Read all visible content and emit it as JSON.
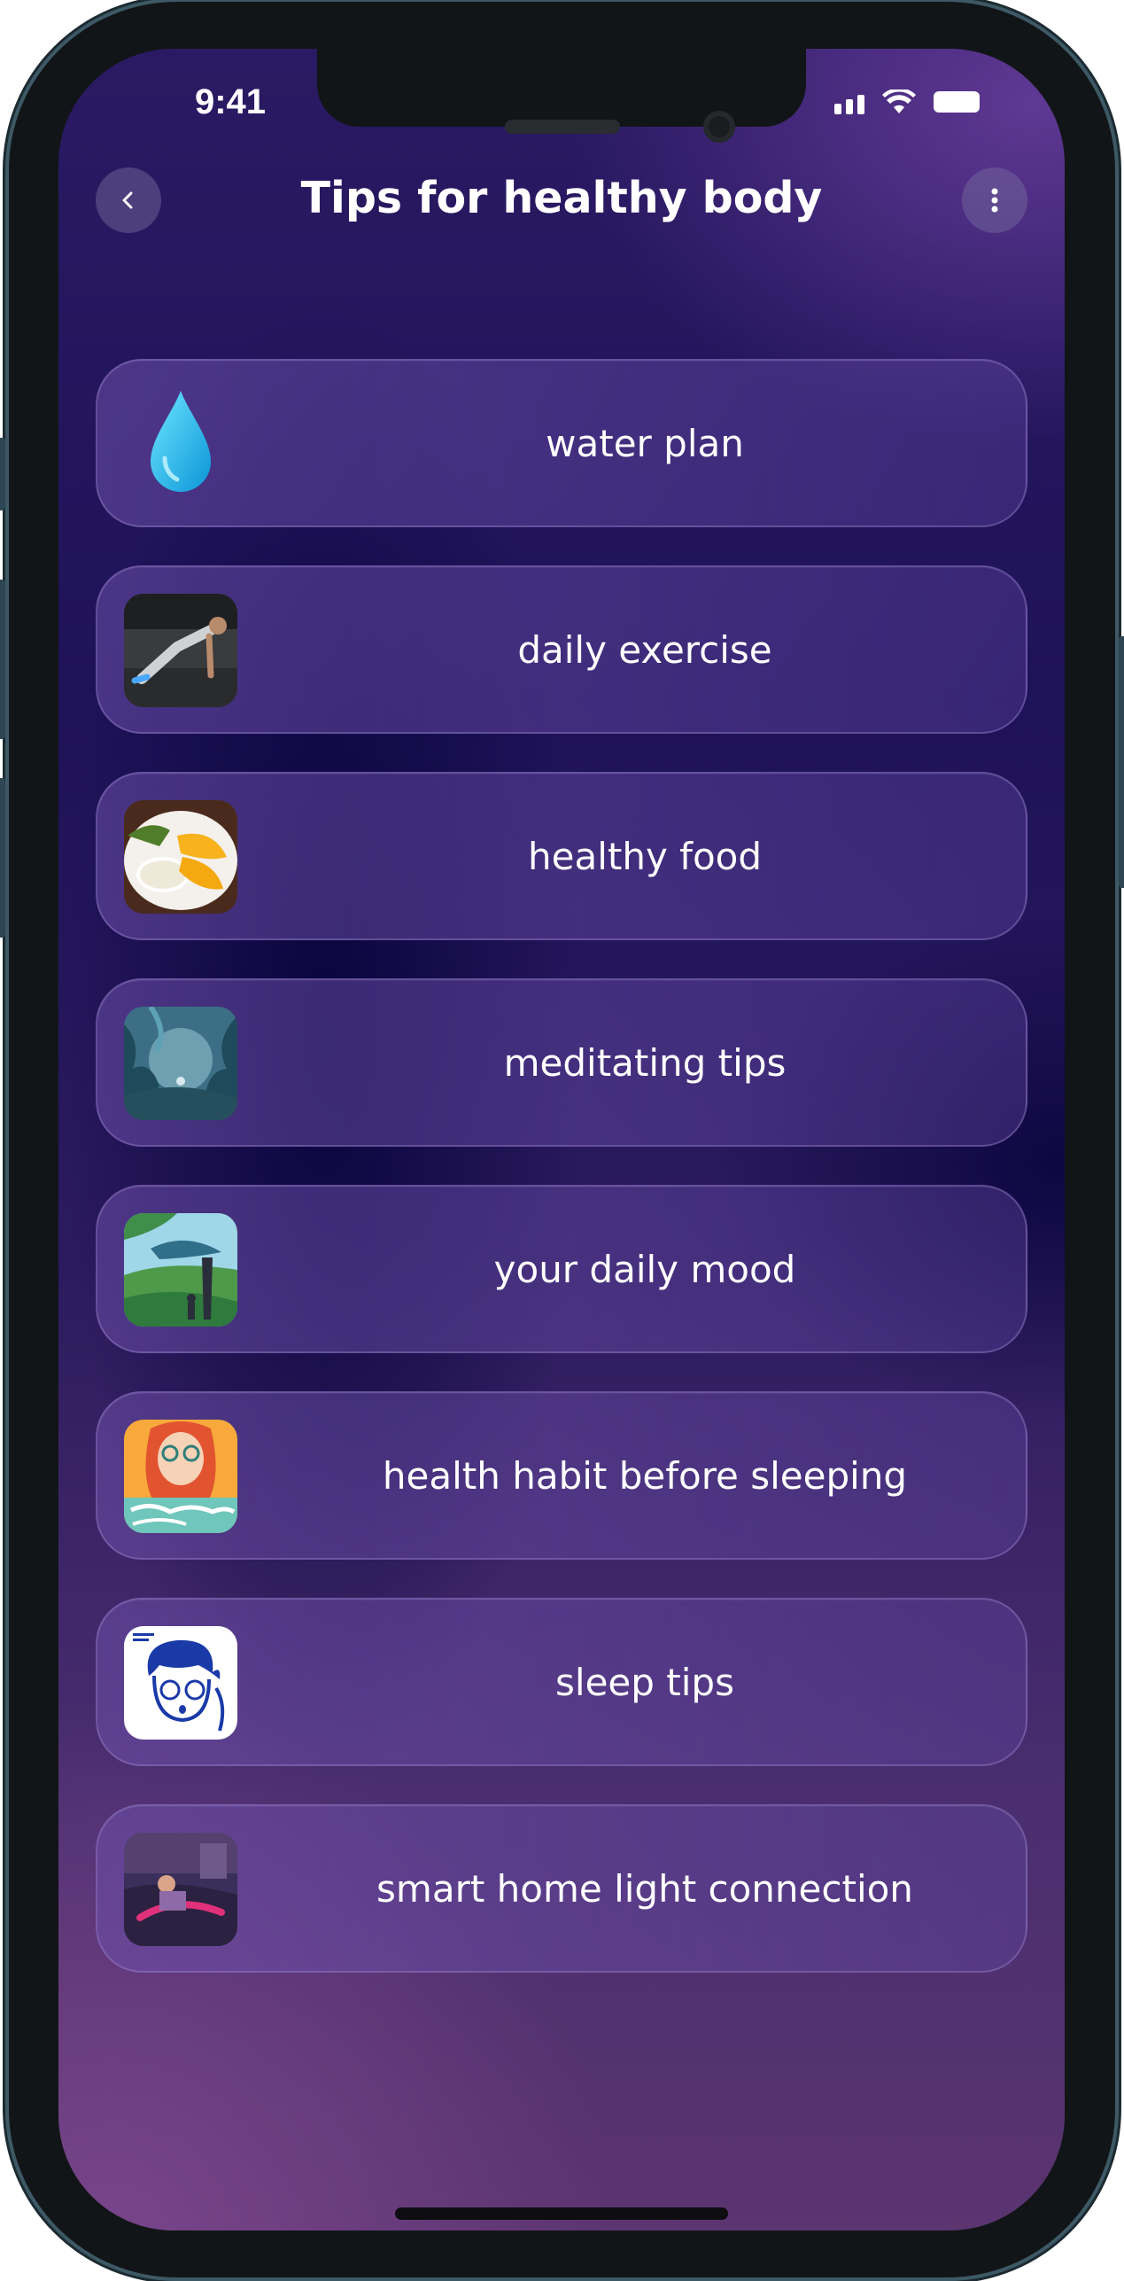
{
  "status_bar": {
    "time": "9:41",
    "icons": [
      "signal-icon",
      "wifi-icon",
      "battery-icon"
    ]
  },
  "header": {
    "title": "Tips for healthy body",
    "back_icon": "chevron-left-icon",
    "menu_icon": "more-vertical-icon"
  },
  "tips": [
    {
      "label": "water plan",
      "thumb": "water-drop-icon"
    },
    {
      "label": "daily exercise",
      "thumb": "exercise-photo"
    },
    {
      "label": "healthy food",
      "thumb": "food-photo"
    },
    {
      "label": "meditating tips",
      "thumb": "forest-illustration"
    },
    {
      "label": "your daily mood",
      "thumb": "landscape-illustration"
    },
    {
      "label": "health habit before sleeping",
      "thumb": "book-cover"
    },
    {
      "label": "sleep tips",
      "thumb": "face-illustration"
    },
    {
      "label": "smart home light connection",
      "thumb": "bedroom-photo"
    }
  ],
  "colors": {
    "background_top": "#2a1a63",
    "background_bottom": "#5b3470",
    "card_border": "#8f7cc7",
    "text": "#ffffff"
  }
}
